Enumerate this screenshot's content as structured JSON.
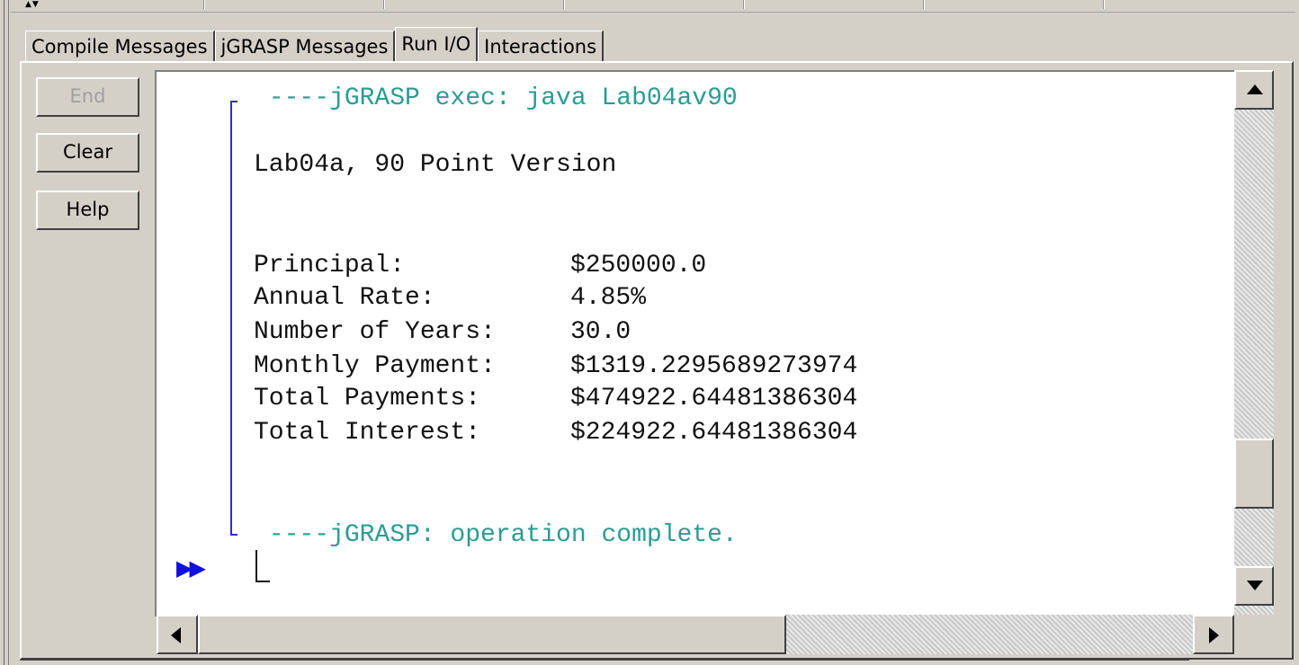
{
  "tabs": [
    {
      "label": "Compile Messages",
      "active": false
    },
    {
      "label": "jGRASP Messages",
      "active": false
    },
    {
      "label": "Run I/O",
      "active": true
    },
    {
      "label": "Interactions",
      "active": false
    }
  ],
  "buttons": {
    "end": "End",
    "clear": "Clear",
    "help": "Help"
  },
  "output": {
    "exec_line": " ----jGRASP exec: java Lab04av90",
    "title_line": "Lab04a, 90 Point Version",
    "rows": [
      {
        "label": "Principal:",
        "value": "$250000.0"
      },
      {
        "label": "Annual Rate:",
        "value": "4.85%"
      },
      {
        "label": "Number of Years:",
        "value": "30.0"
      },
      {
        "label": "Monthly Payment:",
        "value": "$1319.2295689273974"
      },
      {
        "label": "Total Payments:",
        "value": "$474922.64481386304"
      },
      {
        "label": "Total Interest:",
        "value": "$224922.64481386304"
      }
    ],
    "complete_line": " ----jGRASP: operation complete."
  },
  "prompt_glyph": "▶▶",
  "colors": {
    "status_text": "#2a9c94",
    "bracket": "#3030c0",
    "prompt": "#1010e0",
    "background": "#d4d0c8"
  }
}
